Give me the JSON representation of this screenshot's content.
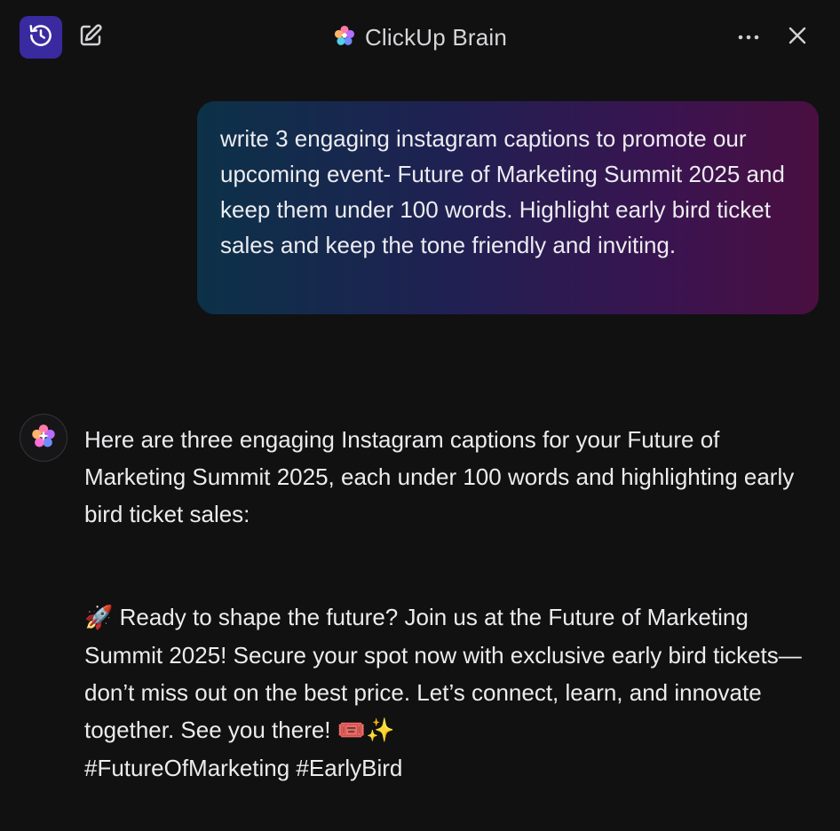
{
  "header": {
    "title": "ClickUp Brain",
    "history_icon": "history-clock-icon",
    "new_chat_icon": "compose-icon",
    "more_icon": "more-dots-icon",
    "close_icon": "close-icon",
    "accent": "#3a2aa0"
  },
  "conversation": {
    "user_prompt": "write 3 engaging instagram captions to promote our upcoming event- Future of Marketing Summit 2025 and keep them under 100 words. Highlight early bird ticket sales and keep the tone friendly and inviting.",
    "assistant_intro": "Here are three engaging Instagram captions for your Future of Marketing Summit 2025, each under 100 words and highlighting early bird ticket sales:",
    "caption_1": {
      "emoji_start": "🚀",
      "text": " Ready to shape the future? Join us at the Future of Marketing Summit 2025! Secure your spot now with exclusive early bird tickets—don’t miss out on the best price. Let’s connect, learn, and innovate together. See you there! ",
      "emoji_end": "🎟️✨",
      "hashtags": "#FutureOfMarketing #EarlyBird"
    }
  }
}
